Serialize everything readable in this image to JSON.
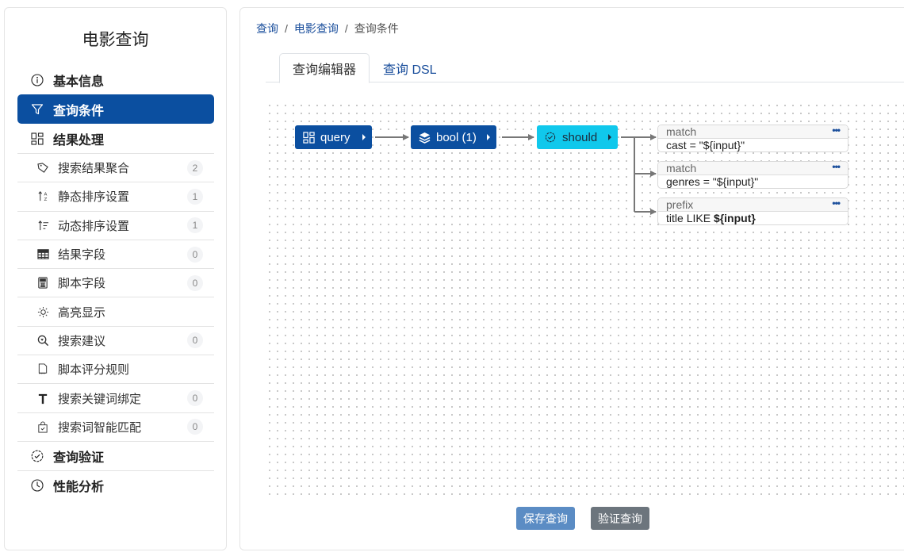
{
  "sidebar": {
    "title": "电影查询",
    "main_items": [
      {
        "label": "基本信息",
        "icon": "info-circle-icon"
      },
      {
        "label": "查询条件",
        "icon": "filter-icon",
        "active": true
      },
      {
        "label": "结果处理",
        "icon": "grid-icon"
      }
    ],
    "sub_items": [
      {
        "label": "搜索结果聚合",
        "icon": "tag-icon",
        "badge": "2"
      },
      {
        "label": "静态排序设置",
        "icon": "sort-alpha-icon",
        "badge": "1"
      },
      {
        "label": "动态排序设置",
        "icon": "sort-lines-icon",
        "badge": "1"
      },
      {
        "label": "结果字段",
        "icon": "table-icon",
        "badge": "0"
      },
      {
        "label": "脚本字段",
        "icon": "calculator-icon",
        "badge": "0"
      },
      {
        "label": "高亮显示",
        "icon": "sun-icon",
        "badge": null
      },
      {
        "label": "搜索建议",
        "icon": "search-suggest-icon",
        "badge": "0"
      },
      {
        "label": "脚本评分规则",
        "icon": "file-script-icon",
        "badge": null
      },
      {
        "label": "搜索关键词绑定",
        "icon": "text-t-icon",
        "badge": "0"
      },
      {
        "label": "搜索词智能匹配",
        "icon": "bag-check-icon",
        "badge": "0"
      }
    ],
    "bottom_items": [
      {
        "label": "查询验证",
        "icon": "check-circle-icon"
      },
      {
        "label": "性能分析",
        "icon": "clock-icon"
      }
    ]
  },
  "breadcrumb": {
    "items": [
      "查询",
      "电影查询"
    ],
    "separator": "/",
    "current": "查询条件"
  },
  "tabs": [
    {
      "label": "查询编辑器",
      "active": true
    },
    {
      "label": "查询 DSL",
      "active": false
    }
  ],
  "editor": {
    "nodes": [
      {
        "label": "query",
        "icon": "grid-icon"
      },
      {
        "label": "bool (1)",
        "icon": "layers-icon"
      },
      {
        "label": "should",
        "icon": "check-circle-icon"
      }
    ],
    "leaves": [
      {
        "type": "match",
        "field": "cast",
        "op": "=",
        "value": "\"${input}\"",
        "more": "•••"
      },
      {
        "type": "match",
        "field": "genres",
        "op": "=",
        "value": "\"${input}\"",
        "more": "•••"
      },
      {
        "type": "prefix",
        "field": "title",
        "op": "LIKE",
        "value": "${input}",
        "more": "•••"
      }
    ]
  },
  "buttons": {
    "save": "保存查询",
    "verify": "验证查询"
  },
  "colors": {
    "primary": "#0b4fa0",
    "should_node": "#10c8ec",
    "save_button": "#5b8cc4",
    "verify_button": "#6c757d"
  }
}
